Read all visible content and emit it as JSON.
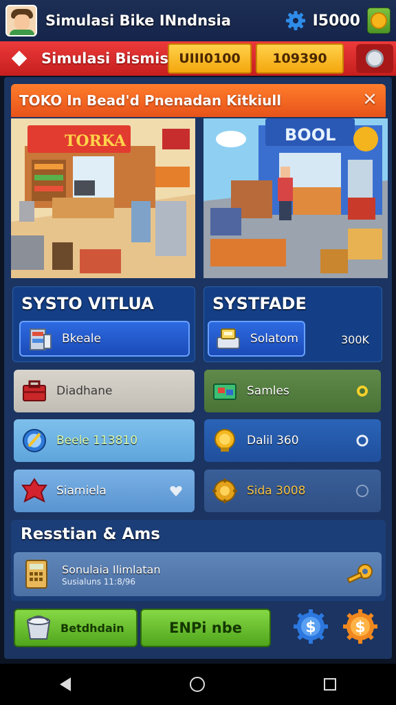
{
  "header": {
    "title": "Simulasi Bike INndnsia",
    "coins": "I5000",
    "avatar_icon": "player-avatar",
    "settings_icon": "gear-icon",
    "coin_icon": "gold-coin-icon"
  },
  "subheader": {
    "title": "Simulasi Bismis",
    "value1": "UIII0100",
    "value2": "109390",
    "search_icon": "magnifier-icon"
  },
  "banner": {
    "title": "TOKO In Bead'd Pnenadan Kitkiull",
    "close_icon": "close-icon"
  },
  "scenes": {
    "left_sign": "TORKA",
    "right_sign": "BOOL"
  },
  "left_section": {
    "title": "SYSTO VITLUA",
    "primary": {
      "label": "Bkeale",
      "icon": "shop-shelf-icon"
    },
    "items": [
      {
        "label": "Diadhane",
        "icon": "toolbox-icon",
        "status": ""
      },
      {
        "label": "Beele 113810",
        "icon": "crystal-orb-icon",
        "status": ""
      },
      {
        "label": "Siamiela",
        "icon": "red-gem-icon",
        "status": "heart"
      }
    ]
  },
  "right_section": {
    "title": "SYSTFADE",
    "primary": {
      "label": "Solatom",
      "value": "300K",
      "icon": "register-icon"
    },
    "items": [
      {
        "label": "Samles",
        "icon": "cash-icon",
        "status": "active"
      },
      {
        "label": "Dalil 360",
        "icon": "gold-trophy-icon",
        "status": "ring"
      },
      {
        "label": "Sida 3008",
        "icon": "cog-coin-icon",
        "status": "dim"
      }
    ]
  },
  "resources": {
    "title": "Resstian & Ams",
    "row_title": "Sonulaia Ilimlatan",
    "row_subtitle": "Susialuns 11:8/96",
    "row_icon": "calculator-icon",
    "end_icon": "key-icon"
  },
  "actions": {
    "btn1_label": "Betdhdain",
    "btn1_icon": "bucket-icon",
    "btn2_label": "ENPi nbe",
    "icon_a": "blue-dollar-badge",
    "icon_b": "orange-dollar-badge"
  },
  "colors": {
    "red": "#d42424",
    "yellow": "#f5b020",
    "green": "#62bd2a",
    "blue": "#1f56c8",
    "navy": "#1b3461",
    "orange": "#f36a24"
  }
}
